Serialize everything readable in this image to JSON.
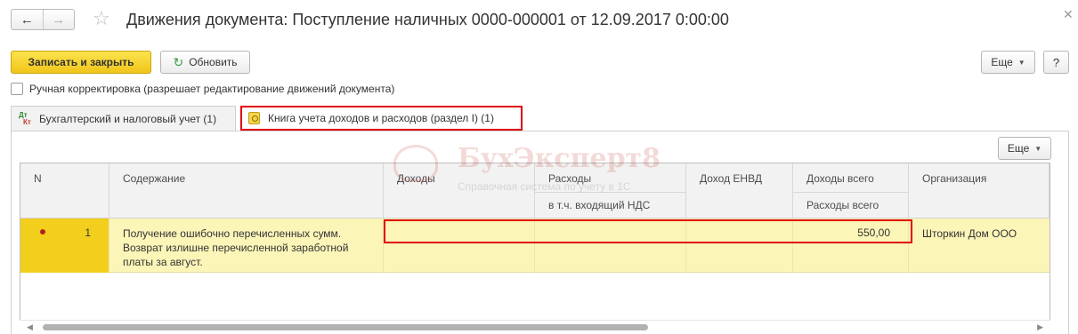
{
  "window": {
    "title": "Движения документа: Поступление наличных 0000-000001 от 12.09.2017 0:00:00",
    "back_icon": "arrow-left-icon",
    "forward_icon": "arrow-right-icon",
    "favorite_icon": "star-icon",
    "close_icon": "close-icon"
  },
  "toolbar": {
    "save_close_label": "Записать и закрыть",
    "refresh_label": "Обновить",
    "more_label": "Еще",
    "help_label": "?"
  },
  "manual_correction": {
    "label": "Ручная корректировка (разрешает редактирование движений документа)",
    "checked": false
  },
  "tabs": [
    {
      "label": "Бухгалтерский и налоговый учет (1)",
      "icon": "dt-kt-icon",
      "active": false
    },
    {
      "label": "Книга учета доходов и расходов (раздел I) (1)",
      "icon": "book-icon",
      "active": true
    }
  ],
  "table": {
    "more_label": "Еще",
    "columns": {
      "n": "N",
      "content": "Содержание",
      "income": "Доходы",
      "expenses": "Расходы",
      "expenses_vat": "в т.ч. входящий НДС",
      "envd_income": "Доход ЕНВД",
      "total_income": "Доходы всего",
      "total_expenses": "Расходы всего",
      "organization": "Организация"
    },
    "rows": [
      {
        "n": "1",
        "content_line1": "Получение ошибочно перечисленных сумм.",
        "content_line2": "Возврат излишне перечисленной заработной",
        "content_line3": "платы за август.",
        "income": "",
        "expenses": "",
        "envd_income": "",
        "total": "550,00",
        "organization": "Шторкин Дом ООО"
      }
    ]
  },
  "watermark": {
    "brand": "БухЭксперт8",
    "tagline": "Справочная система по учету в 1С"
  },
  "colors": {
    "primary_button": "#f1c51a",
    "selected_row": "#fbf5b8",
    "highlight_border": "#e00000"
  }
}
